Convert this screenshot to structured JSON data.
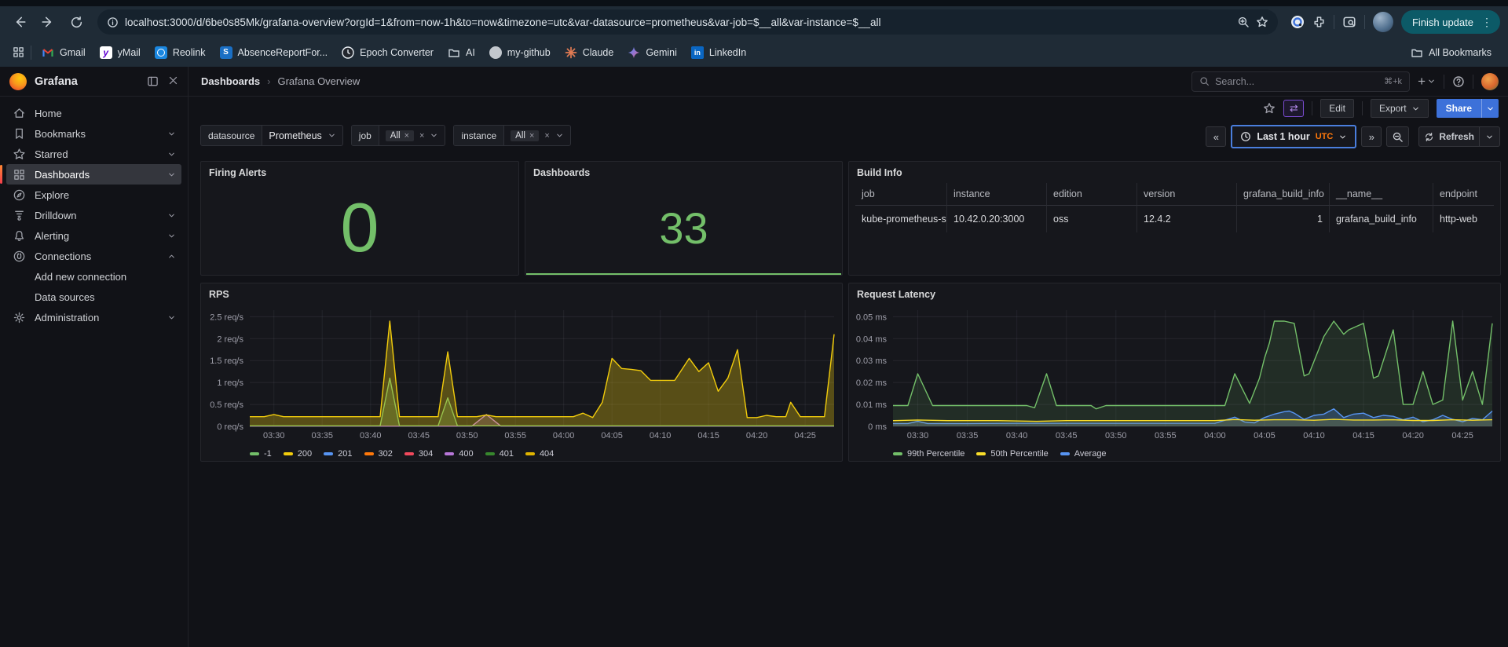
{
  "browser": {
    "url": "localhost:3000/d/6be0s85Mk/grafana-overview?orgId=1&from=now-1h&to=now&timezone=utc&var-datasource=prometheus&var-job=$__all&var-instance=$__all",
    "finish_update_label": "Finish update",
    "all_bookmarks_label": "All Bookmarks",
    "bookmarks": [
      {
        "label": "Gmail",
        "icon": "gmail"
      },
      {
        "label": "yMail",
        "icon": "ymail"
      },
      {
        "label": "Reolink",
        "icon": "reolink"
      },
      {
        "label": "AbsenceReportFor...",
        "icon": "sharepoint"
      },
      {
        "label": "Epoch Converter",
        "icon": "clockface"
      },
      {
        "label": "AI",
        "icon": "folder"
      },
      {
        "label": "my-github",
        "icon": "github"
      },
      {
        "label": "Claude",
        "icon": "claude"
      },
      {
        "label": "Gemini",
        "icon": "gemini"
      },
      {
        "label": "LinkedIn",
        "icon": "linkedin"
      }
    ]
  },
  "app": {
    "brand": "Grafana",
    "breadcrumb": {
      "parent": "Dashboards",
      "current": "Grafana Overview"
    },
    "search": {
      "placeholder": "Search...",
      "shortcut": "⌘+k"
    },
    "toolbar": {
      "edit": "Edit",
      "export": "Export",
      "share": "Share"
    },
    "sidebar": [
      {
        "label": "Home",
        "icon": "home"
      },
      {
        "label": "Bookmarks",
        "icon": "bookmark",
        "chevron": "down"
      },
      {
        "label": "Starred",
        "icon": "star2",
        "chevron": "down"
      },
      {
        "label": "Dashboards",
        "icon": "apps",
        "chevron": "down",
        "active": true
      },
      {
        "label": "Explore",
        "icon": "compass"
      },
      {
        "label": "Drilldown",
        "icon": "drill",
        "chevron": "down"
      },
      {
        "label": "Alerting",
        "icon": "bell",
        "chevron": "down"
      },
      {
        "label": "Connections",
        "icon": "plug",
        "chevron": "up"
      },
      {
        "label": "Add new connection",
        "sub": true
      },
      {
        "label": "Data sources",
        "sub": true
      },
      {
        "label": "Administration",
        "icon": "gear",
        "chevron": "down"
      }
    ],
    "variables": [
      {
        "label": "datasource",
        "value": "Prometheus",
        "type": "dropdown"
      },
      {
        "label": "job",
        "value": "All",
        "type": "multi"
      },
      {
        "label": "instance",
        "value": "All",
        "type": "multi"
      }
    ],
    "timepicker": {
      "range_label": "Last 1 hour",
      "timezone": "UTC",
      "refresh_label": "Refresh"
    }
  },
  "panels": {
    "firing_alerts": {
      "title": "Firing Alerts",
      "value": "0",
      "color": "#73BF69"
    },
    "dashboards": {
      "title": "Dashboards",
      "value": "33",
      "color": "#73BF69"
    },
    "build_info": {
      "title": "Build Info",
      "columns": [
        "job",
        "instance",
        "edition",
        "version",
        "grafana_build_info",
        "__name__",
        "endpoint"
      ],
      "rows": [
        [
          "kube-prometheus-sta",
          "10.42.0.20:3000",
          "oss",
          "12.4.2",
          "1",
          "grafana_build_info",
          "http-web"
        ]
      ],
      "right_align_columns": [
        4
      ]
    }
  },
  "chart_data": [
    {
      "type": "area",
      "title": "RPS",
      "t_range": [
        27.5,
        88
      ],
      "ylim": [
        0,
        2.65
      ],
      "x_ticks": [
        {
          "t": 30,
          "label": "03:30"
        },
        {
          "t": 35,
          "label": "03:35"
        },
        {
          "t": 40,
          "label": "03:40"
        },
        {
          "t": 45,
          "label": "03:45"
        },
        {
          "t": 50,
          "label": "03:50"
        },
        {
          "t": 55,
          "label": "03:55"
        },
        {
          "t": 60,
          "label": "04:00"
        },
        {
          "t": 65,
          "label": "04:05"
        },
        {
          "t": 70,
          "label": "04:10"
        },
        {
          "t": 75,
          "label": "04:15"
        },
        {
          "t": 80,
          "label": "04:20"
        },
        {
          "t": 85,
          "label": "04:25"
        }
      ],
      "y_ticks": [
        {
          "v": 0,
          "label": "0 req/s"
        },
        {
          "v": 0.5,
          "label": "0.5 req/s"
        },
        {
          "v": 1,
          "label": "1 req/s"
        },
        {
          "v": 1.5,
          "label": "1.5 req/s"
        },
        {
          "v": 2,
          "label": "2 req/s"
        },
        {
          "v": 2.5,
          "label": "2.5 req/s"
        }
      ],
      "legend": [
        {
          "label": "-1",
          "color": "#73BF69"
        },
        {
          "label": "200",
          "color": "#F2CC0C"
        },
        {
          "label": "201",
          "color": "#5794F2"
        },
        {
          "label": "302",
          "color": "#FF780A"
        },
        {
          "label": "304",
          "color": "#F2495C"
        },
        {
          "label": "400",
          "color": "#B877D9"
        },
        {
          "label": "401",
          "color": "#37872D"
        },
        {
          "label": "404",
          "color": "#E0B400"
        }
      ],
      "series": [
        {
          "name": "400",
          "color": "#B877D9",
          "fill_opacity": 0.22,
          "points": [
            [
              27.5,
              0.005
            ],
            [
              50.5,
              0.005
            ],
            [
              52,
              0.27
            ],
            [
              53.5,
              0.005
            ],
            [
              88,
              0.005
            ]
          ]
        },
        {
          "name": "-1",
          "color": "#73BF69",
          "fill_opacity": 0.25,
          "points": [
            [
              27.5,
              0.012
            ],
            [
              41,
              0.012
            ],
            [
              42,
              1.1
            ],
            [
              43,
              0.012
            ],
            [
              47,
              0.012
            ],
            [
              48,
              0.65
            ],
            [
              49,
              0.012
            ],
            [
              88,
              0.012
            ]
          ]
        },
        {
          "name": "200",
          "color": "#F2CC0C",
          "fill_opacity": 0.3,
          "points": [
            [
              27.5,
              0.22
            ],
            [
              29,
              0.22
            ],
            [
              30,
              0.27
            ],
            [
              31,
              0.22
            ],
            [
              36,
              0.22
            ],
            [
              41,
              0.22
            ],
            [
              42,
              2.4
            ],
            [
              43,
              0.22
            ],
            [
              47,
              0.22
            ],
            [
              48,
              1.7
            ],
            [
              49,
              0.22
            ],
            [
              51,
              0.22
            ],
            [
              52,
              0.26
            ],
            [
              53,
              0.22
            ],
            [
              58,
              0.22
            ],
            [
              61,
              0.22
            ],
            [
              62,
              0.3
            ],
            [
              63,
              0.2
            ],
            [
              64,
              0.55
            ],
            [
              65,
              1.55
            ],
            [
              66,
              1.32
            ],
            [
              67,
              1.3
            ],
            [
              68,
              1.27
            ],
            [
              69,
              1.05
            ],
            [
              71.5,
              1.05
            ],
            [
              73,
              1.55
            ],
            [
              74,
              1.25
            ],
            [
              75,
              1.45
            ],
            [
              76,
              0.8
            ],
            [
              77,
              1.1
            ],
            [
              78,
              1.75
            ],
            [
              79,
              0.2
            ],
            [
              80,
              0.2
            ],
            [
              81,
              0.25
            ],
            [
              82,
              0.22
            ],
            [
              83,
              0.22
            ],
            [
              83.5,
              0.55
            ],
            [
              84.5,
              0.22
            ],
            [
              86,
              0.22
            ],
            [
              87,
              0.22
            ],
            [
              88,
              2.1
            ]
          ]
        }
      ]
    },
    {
      "type": "area",
      "title": "Request Latency",
      "t_range": [
        27.5,
        88
      ],
      "ylim": [
        0,
        0.053
      ],
      "x_ticks": [
        {
          "t": 30,
          "label": "03:30"
        },
        {
          "t": 35,
          "label": "03:35"
        },
        {
          "t": 40,
          "label": "03:40"
        },
        {
          "t": 45,
          "label": "03:45"
        },
        {
          "t": 50,
          "label": "03:50"
        },
        {
          "t": 55,
          "label": "03:55"
        },
        {
          "t": 60,
          "label": "04:00"
        },
        {
          "t": 65,
          "label": "04:05"
        },
        {
          "t": 70,
          "label": "04:10"
        },
        {
          "t": 75,
          "label": "04:15"
        },
        {
          "t": 80,
          "label": "04:20"
        },
        {
          "t": 85,
          "label": "04:25"
        }
      ],
      "y_ticks": [
        {
          "v": 0,
          "label": "0 ms"
        },
        {
          "v": 0.01,
          "label": "0.01 ms"
        },
        {
          "v": 0.02,
          "label": "0.02 ms"
        },
        {
          "v": 0.03,
          "label": "0.03 ms"
        },
        {
          "v": 0.04,
          "label": "0.04 ms"
        },
        {
          "v": 0.05,
          "label": "0.05 ms"
        }
      ],
      "legend": [
        {
          "label": "99th Percentile",
          "color": "#73BF69"
        },
        {
          "label": "50th Percentile",
          "color": "#FADE2A"
        },
        {
          "label": "Average",
          "color": "#5794F2"
        }
      ],
      "series": [
        {
          "name": "99th Percentile",
          "color": "#73BF69",
          "fill_opacity": 0.13,
          "points": [
            [
              27.5,
              0.0095
            ],
            [
              29,
              0.0095
            ],
            [
              30,
              0.024
            ],
            [
              31.5,
              0.0095
            ],
            [
              38,
              0.0095
            ],
            [
              41,
              0.0095
            ],
            [
              41.8,
              0.0085
            ],
            [
              43,
              0.024
            ],
            [
              44,
              0.0095
            ],
            [
              47.5,
              0.0095
            ],
            [
              48,
              0.008
            ],
            [
              49,
              0.0095
            ],
            [
              55,
              0.0095
            ],
            [
              61,
              0.0095
            ],
            [
              62,
              0.024
            ],
            [
              63.5,
              0.0105
            ],
            [
              64.5,
              0.022
            ],
            [
              65,
              0.031
            ],
            [
              65.5,
              0.038
            ],
            [
              66,
              0.048
            ],
            [
              67,
              0.048
            ],
            [
              68,
              0.047
            ],
            [
              69,
              0.023
            ],
            [
              69.5,
              0.024
            ],
            [
              71,
              0.041
            ],
            [
              72,
              0.048
            ],
            [
              72.5,
              0.045
            ],
            [
              73,
              0.042
            ],
            [
              73.5,
              0.044
            ],
            [
              74.5,
              0.046
            ],
            [
              75,
              0.047
            ],
            [
              76,
              0.022
            ],
            [
              76.5,
              0.023
            ],
            [
              78,
              0.044
            ],
            [
              79,
              0.01
            ],
            [
              80,
              0.01
            ],
            [
              81,
              0.025
            ],
            [
              82,
              0.01
            ],
            [
              83,
              0.012
            ],
            [
              84,
              0.048
            ],
            [
              85,
              0.012
            ],
            [
              86,
              0.025
            ],
            [
              87,
              0.01
            ],
            [
              88,
              0.047
            ]
          ]
        },
        {
          "name": "Average",
          "color": "#5794F2",
          "fill_opacity": 0.25,
          "points": [
            [
              27.5,
              0.0013
            ],
            [
              29,
              0.0013
            ],
            [
              30,
              0.0023
            ],
            [
              31,
              0.0013
            ],
            [
              35,
              0.0013
            ],
            [
              40,
              0.0014
            ],
            [
              45,
              0.0014
            ],
            [
              50,
              0.0014
            ],
            [
              55,
              0.0014
            ],
            [
              60,
              0.0014
            ],
            [
              62,
              0.0042
            ],
            [
              63,
              0.002
            ],
            [
              64,
              0.0016
            ],
            [
              65,
              0.004
            ],
            [
              66,
              0.0056
            ],
            [
              67,
              0.0067
            ],
            [
              67.5,
              0.007
            ],
            [
              68,
              0.006
            ],
            [
              69,
              0.0032
            ],
            [
              70,
              0.005
            ],
            [
              71,
              0.0056
            ],
            [
              72,
              0.008
            ],
            [
              73,
              0.004
            ],
            [
              74,
              0.0056
            ],
            [
              75,
              0.006
            ],
            [
              76,
              0.004
            ],
            [
              77,
              0.005
            ],
            [
              78,
              0.0046
            ],
            [
              79,
              0.003
            ],
            [
              80,
              0.0042
            ],
            [
              81,
              0.0021
            ],
            [
              82,
              0.003
            ],
            [
              83,
              0.005
            ],
            [
              84,
              0.0032
            ],
            [
              85,
              0.0021
            ],
            [
              86,
              0.0036
            ],
            [
              87,
              0.003
            ],
            [
              88,
              0.007
            ]
          ]
        },
        {
          "name": "50th Percentile",
          "color": "#FADE2A",
          "fill_opacity": 0.12,
          "points": [
            [
              27.5,
              0.0026
            ],
            [
              30,
              0.0029
            ],
            [
              33,
              0.0026
            ],
            [
              38,
              0.0026
            ],
            [
              42,
              0.0023
            ],
            [
              45,
              0.0026
            ],
            [
              48,
              0.0026
            ],
            [
              52,
              0.0026
            ],
            [
              56,
              0.0026
            ],
            [
              60,
              0.0026
            ],
            [
              62,
              0.0031
            ],
            [
              64,
              0.0028
            ],
            [
              66,
              0.003
            ],
            [
              68,
              0.003
            ],
            [
              70,
              0.0028
            ],
            [
              72,
              0.0032
            ],
            [
              74,
              0.0029
            ],
            [
              76,
              0.0029
            ],
            [
              78,
              0.003
            ],
            [
              80,
              0.0027
            ],
            [
              82,
              0.0027
            ],
            [
              84,
              0.003
            ],
            [
              86,
              0.0028
            ],
            [
              88,
              0.003
            ]
          ]
        }
      ]
    }
  ],
  "colors": {
    "stat_green": "#73BF69",
    "share_blue": "#3D71D9",
    "utc_orange": "#FF780A",
    "active_accent": "#F55F3E"
  }
}
